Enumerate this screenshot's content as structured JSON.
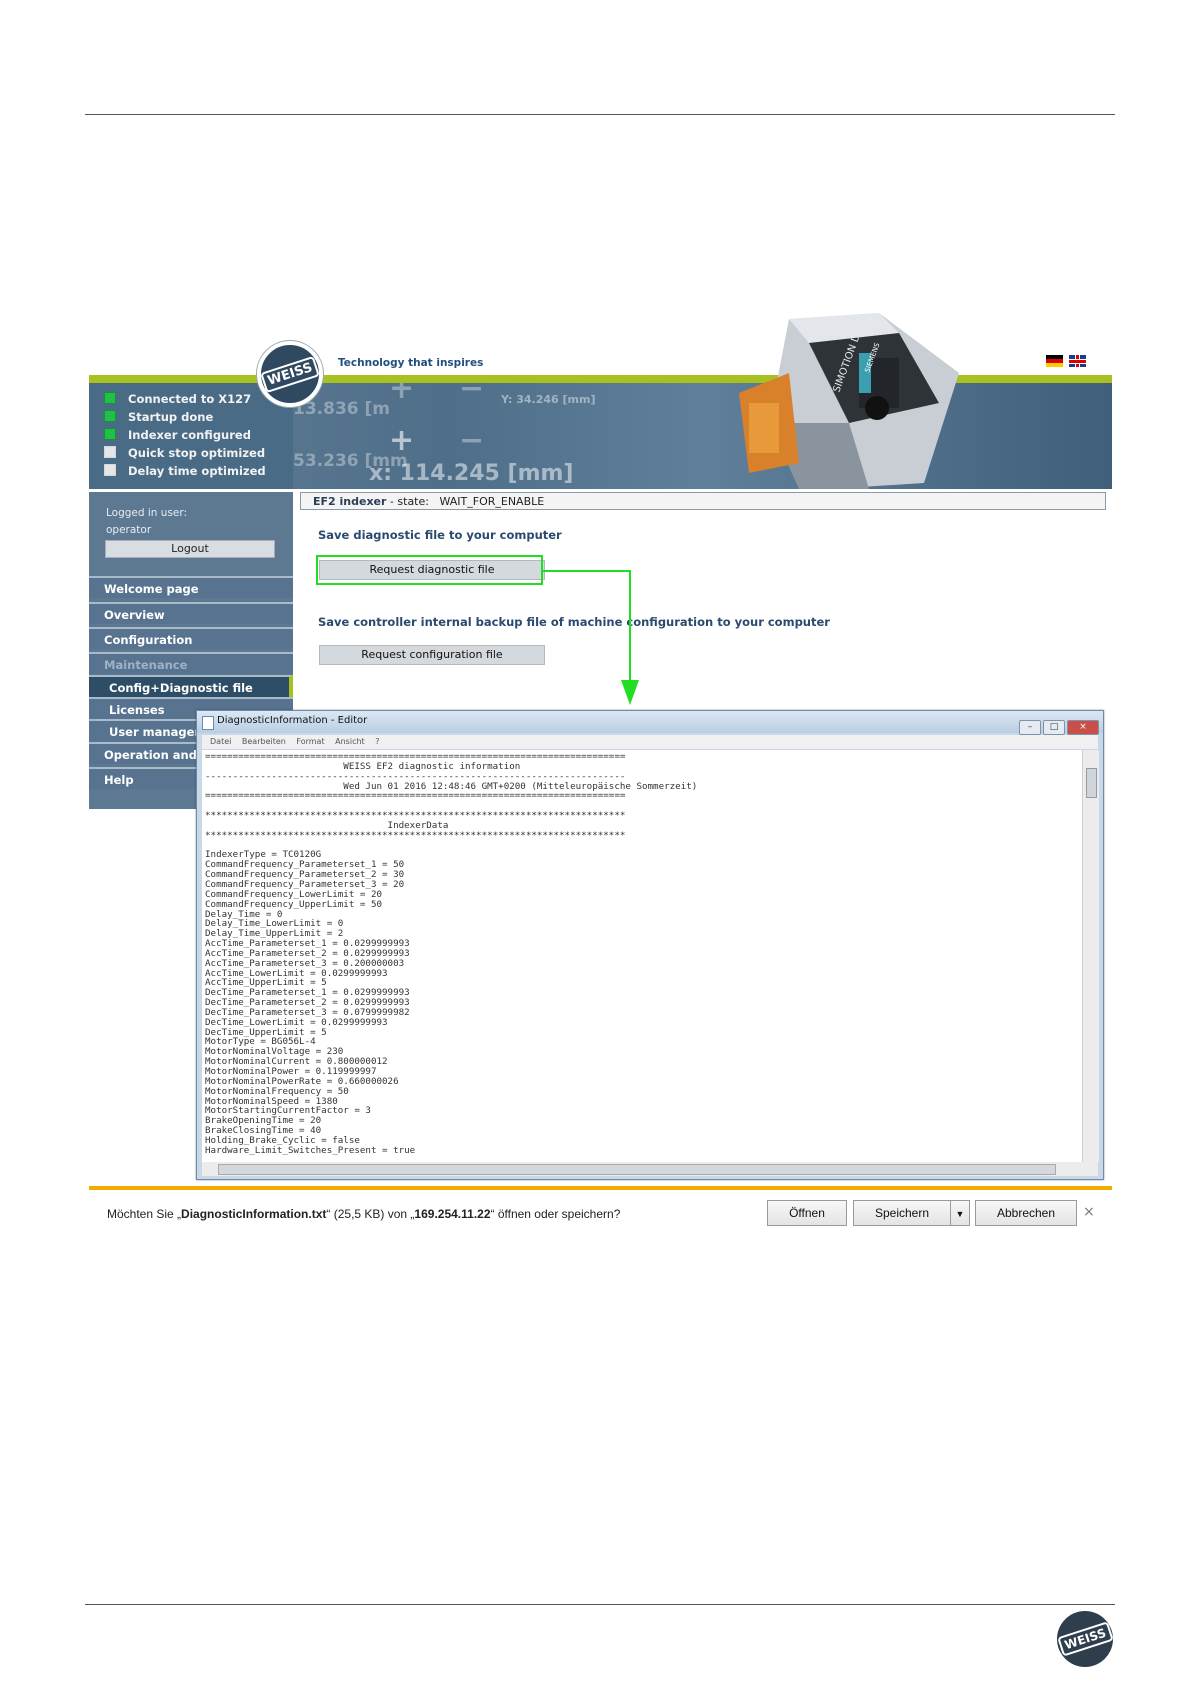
{
  "header": {
    "tagline": "Technology that inspires",
    "logo_text": "WEISS",
    "status_items": [
      {
        "label": "Connected to X127",
        "checked": true
      },
      {
        "label": "Startup done",
        "checked": true
      },
      {
        "label": "Indexer configured",
        "checked": true
      },
      {
        "label": "Quick stop optimized",
        "checked": false
      },
      {
        "label": "Delay time optimized",
        "checked": false
      }
    ],
    "banner_readouts": [
      "Y: 34.246 [mm]",
      "13.836 [m",
      "53.236 [mm",
      "x: 114.245 [mm]"
    ],
    "device_label": "SIMOTION D",
    "device_brand": "SIEMENS"
  },
  "sidebar": {
    "logged_in_label": "Logged in user:",
    "user": "operator",
    "logout_label": "Logout",
    "items": [
      {
        "label": "Welcome page"
      },
      {
        "label": "Overview"
      },
      {
        "label": "Configuration"
      },
      {
        "label": "Maintenance"
      },
      {
        "label": "Config+Diagnostic file"
      },
      {
        "label": "Licenses"
      },
      {
        "label": "User manager"
      },
      {
        "label": "Operation and"
      },
      {
        "label": "Help"
      }
    ]
  },
  "main": {
    "indexer_label": "EF2 indexer",
    "state_label": " - state:",
    "state_value": "WAIT_FOR_ENABLE",
    "section1_heading": "Save diagnostic file to your computer",
    "section1_button": "Request diagnostic file",
    "section2_heading": "Save controller internal backup file of machine configuration to your computer",
    "section2_button": "Request configuration file"
  },
  "editor": {
    "title": "DiagnosticInformation - Editor",
    "menu": [
      "Datei",
      "Bearbeiten",
      "Format",
      "Ansicht",
      "?"
    ],
    "content": "============================================================================\n                         WEISS EF2 diagnostic information\n----------------------------------------------------------------------------\n                         Wed Jun 01 2016 12:48:46 GMT+0200 (Mitteleuropäische Sommerzeit)\n============================================================================\n\n****************************************************************************\n                                 IndexerData\n****************************************************************************\n\nIndexerType = TC0120G\nCommandFrequency_Parameterset_1 = 50\nCommandFrequency_Parameterset_2 = 30\nCommandFrequency_Parameterset_3 = 20\nCommandFrequency_LowerLimit = 20\nCommandFrequency_UpperLimit = 50\nDelay_Time = 0\nDelay_Time_LowerLimit = 0\nDelay_Time_UpperLimit = 2\nAccTime_Parameterset_1 = 0.0299999993\nAccTime_Parameterset_2 = 0.0299999993\nAccTime_Parameterset_3 = 0.200000003\nAccTime_LowerLimit = 0.0299999993\nAccTime_UpperLimit = 5\nDecTime_Parameterset_1 = 0.0299999993\nDecTime_Parameterset_2 = 0.0299999993\nDecTime_Parameterset_3 = 0.0799999982\nDecTime_LowerLimit = 0.0299999993\nDecTime_UpperLimit = 5\nMotorType = BG056L-4\nMotorNominalVoltage = 230\nMotorNominalCurrent = 0.800000012\nMotorNominalPower = 0.119999997\nMotorNominalPowerRate = 0.660000026\nMotorNominalFrequency = 50\nMotorNominalSpeed = 1380\nMotorStartingCurrentFactor = 3\nBrakeOpeningTime = 20\nBrakeClosingTime = 40\nHolding_Brake_Cyclic = false\nHardware_Limit_Switches_Present = true"
  },
  "download_bar": {
    "prefix": "Möchten Sie „",
    "filename": "DiagnosticInformation.txt",
    "middle": "“ (25,5 KB) von „",
    "host": "169.254.11.22",
    "suffix": "“ öffnen oder speichern?",
    "open_label": "Öffnen",
    "save_label": "Speichern",
    "cancel_label": "Abbrechen",
    "close_glyph": "×"
  },
  "footer": {
    "logo_text": "WEISS"
  },
  "colors": {
    "highlight": "#22dd22",
    "accent_green": "#a8c020",
    "download_accent": "#f0ad00"
  }
}
